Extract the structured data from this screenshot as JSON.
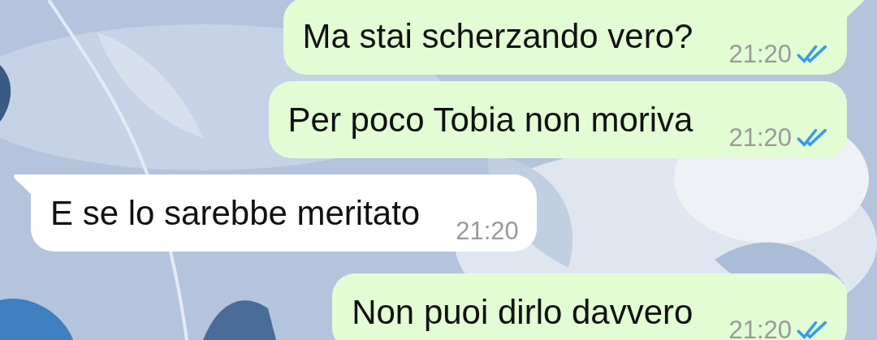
{
  "messages": [
    {
      "kind": "outgoing",
      "text": "Ma stai scherzando vero?",
      "time": "21:20",
      "read": true,
      "tail": true
    },
    {
      "kind": "outgoing",
      "text": "Per poco Tobia non moriva",
      "time": "21:20",
      "read": true,
      "tail": false
    },
    {
      "kind": "incoming",
      "text": "E se lo sarebbe meritato",
      "time": "21:20",
      "tail": true
    },
    {
      "kind": "outgoing",
      "text": "Non puoi dirlo davvero",
      "time": "21:20",
      "read": true,
      "tail": false
    }
  ]
}
